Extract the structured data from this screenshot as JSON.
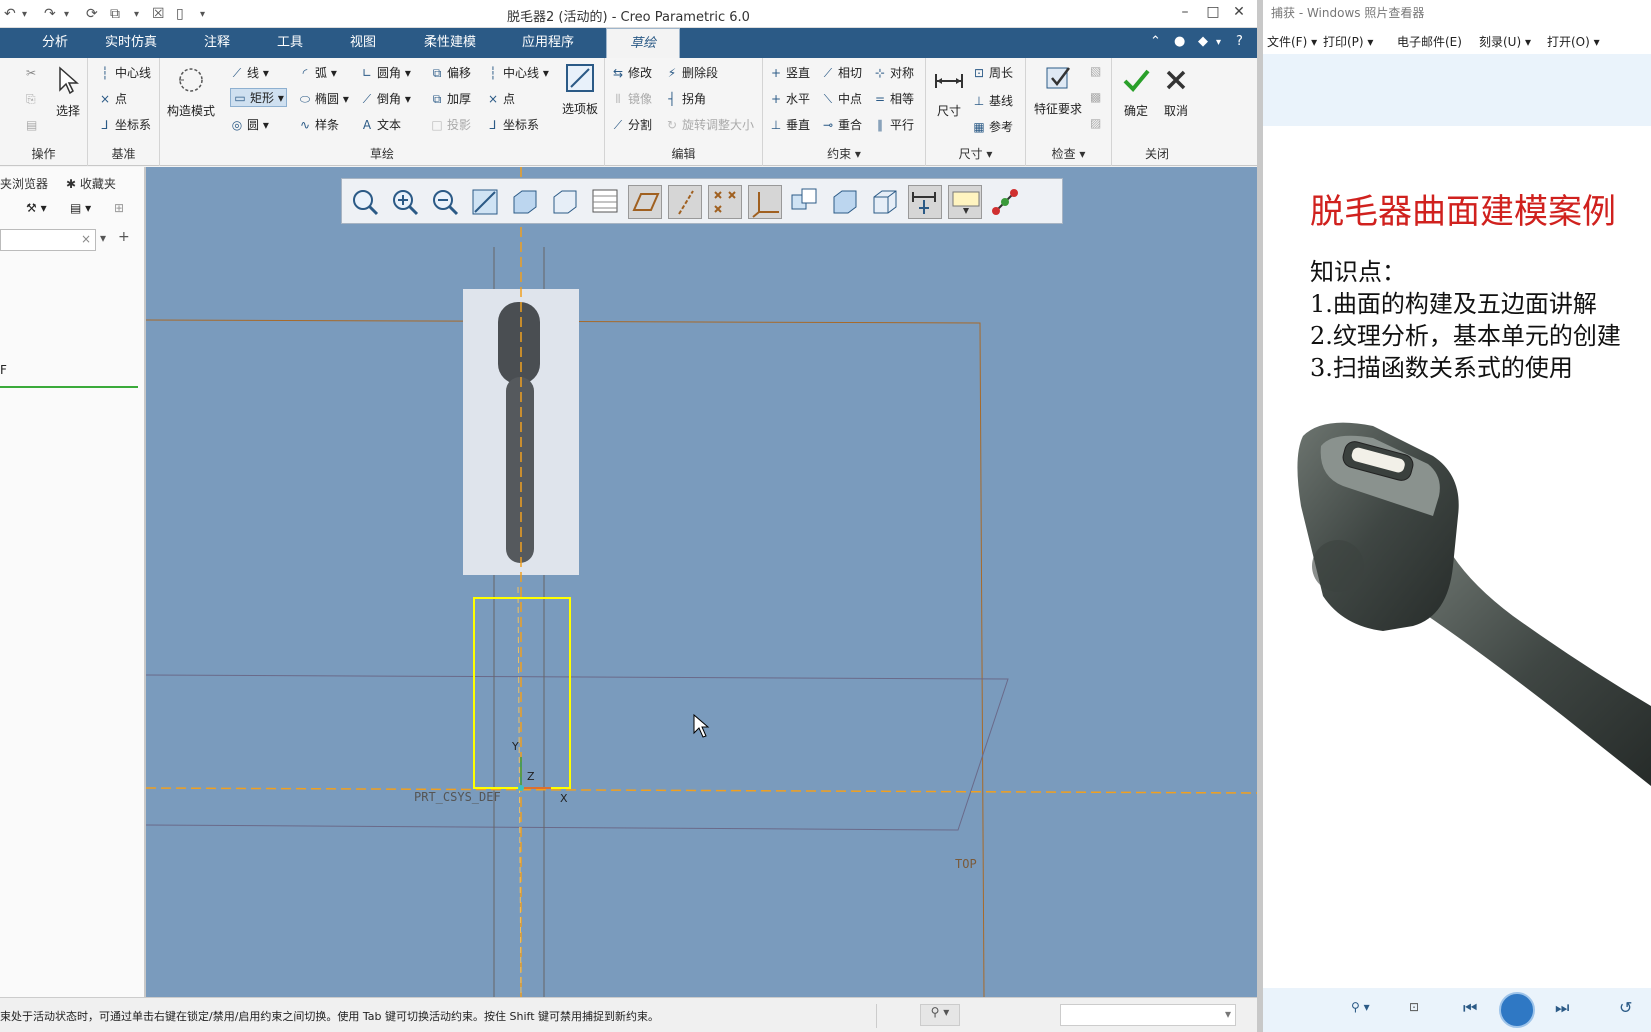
{
  "creo": {
    "title": "脱毛器2 (活动的) - Creo Parametric 6.0",
    "tabs": [
      "分析",
      "实时仿真",
      "注释",
      "工具",
      "视图",
      "柔性建模",
      "应用程序",
      "草绘"
    ],
    "groups": {
      "operations": {
        "label": "操作",
        "select": "选择"
      },
      "datum": {
        "label": "基准",
        "items": [
          "中心线",
          "点",
          "坐标系"
        ]
      },
      "sketch": {
        "label": "草绘",
        "construction_mode": "构造模式",
        "col1": [
          "线",
          "矩形",
          "圆"
        ],
        "col2": [
          "弧",
          "椭圆",
          "样条"
        ],
        "col3": [
          "圆角",
          "倒角",
          "文本"
        ],
        "col4": [
          "偏移",
          "加厚",
          "投影"
        ],
        "col5": [
          "中心线",
          "点",
          "坐标系"
        ],
        "palette": "选项板"
      },
      "edit": {
        "label": "编辑",
        "col1": [
          "修改",
          "镜像",
          "分割"
        ],
        "col2": [
          "删除段",
          "拐角",
          "旋转调整大小"
        ]
      },
      "constrain": {
        "label": "约束",
        "col1": [
          "竖直",
          "水平",
          "垂直"
        ],
        "col2": [
          "相切",
          "中点",
          "重合"
        ],
        "col3": [
          "对称",
          "相等",
          "平行"
        ]
      },
      "dimension": {
        "label": "尺寸",
        "big": "尺寸",
        "items": [
          "周长",
          "基线",
          "参考"
        ]
      },
      "inspect": {
        "label": "检查",
        "big": "特征要求"
      },
      "close": {
        "label": "关闭",
        "ok": "确定",
        "cancel": "取消"
      }
    },
    "left_panel": {
      "tab1": "夹浏览器",
      "tab2": "收藏夹",
      "item": "F"
    },
    "graphics": {
      "csys_label": "PRT_CSYS_DEF",
      "top_label": "TOP",
      "axis_x": "X",
      "axis_y": "Y",
      "axis_z": "Z"
    },
    "status": "束处于活动状态时，可通过单击右键在锁定/禁用/启用约束之间切换。使用 Tab 键可切换活动约束。按住 Shift 键可禁用捕捉到新约束。"
  },
  "viewer": {
    "title": "捕获 - Windows 照片查看器",
    "menu": [
      "文件(F)",
      "打印(P)",
      "电子邮件(E)",
      "刻录(U)",
      "打开(O)"
    ],
    "slide": {
      "title": "脱毛器曲面建模案例",
      "subtitle": "知识点：",
      "points": [
        "1.曲面的构建及五边面讲解",
        "2.纹理分析，基本单元的创建",
        "3.扫描函数关系式的使用"
      ]
    }
  },
  "colors": {
    "ribbon_tab_bg": "#2b5a86",
    "graphics_bg": "#7a9bbd",
    "slide_title": "#d0211e",
    "sketch_rect": "#ffff00"
  }
}
